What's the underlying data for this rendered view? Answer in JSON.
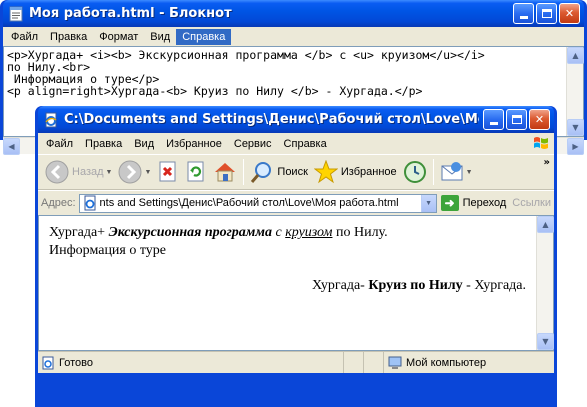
{
  "notepad": {
    "title": "Моя работа.html - Блокнот",
    "menu": [
      "Файл",
      "Правка",
      "Формат",
      "Вид",
      "Справка"
    ],
    "active_menu": "Справка",
    "content_lines": [
      "<p>Хургада+ <i><b> Экскурсионная программа </b> с <u> круизом</u></i>",
      "по Нилу.<br>",
      " Информация о туре</p>",
      "<p align=right>Хургада-<b> Круиз по Нилу </b> - Хургада.</p>"
    ]
  },
  "ie": {
    "title": "C:\\Documents and Settings\\Денис\\Рабочий стол\\Love\\Моя работ...",
    "menu": [
      "Файл",
      "Правка",
      "Вид",
      "Избранное",
      "Сервис",
      "Справка"
    ],
    "toolbar": {
      "back": "Назад",
      "search": "Поиск",
      "favorites": "Избранное",
      "more": "»"
    },
    "address": {
      "label": "Адрес:",
      "url": "nts and Settings\\Денис\\Рабочий стол\\Love\\Моя работа.html",
      "go": "Переход",
      "links": "Ссылки"
    },
    "page": {
      "p1_plain": "Хургада+ ",
      "p1_bolditalic": "Экскурсионная программа",
      "p1_italic_s": " с ",
      "p1_underline": "круизом",
      "p1_tail": " по Нилу.",
      "p1_line2": "Информация о туре",
      "p2_plain1": "Хургада- ",
      "p2_bold": "Круиз по Нилу",
      "p2_plain2": " - Хургада."
    },
    "status": {
      "text": "Готово",
      "zone": "Мой компьютер"
    }
  },
  "colors": {
    "title_blue": "#0055e5",
    "chrome": "#ece9d8",
    "close_red": "#c23a12"
  },
  "icons": [
    "notepad-icon",
    "ie-page-icon",
    "minimize-icon",
    "maximize-icon",
    "close-icon",
    "windows-flag-icon",
    "back-icon",
    "forward-icon",
    "stop-icon",
    "refresh-icon",
    "home-icon",
    "search-icon",
    "favorites-star-icon",
    "history-icon",
    "mail-icon",
    "go-arrow-icon",
    "computer-icon"
  ]
}
